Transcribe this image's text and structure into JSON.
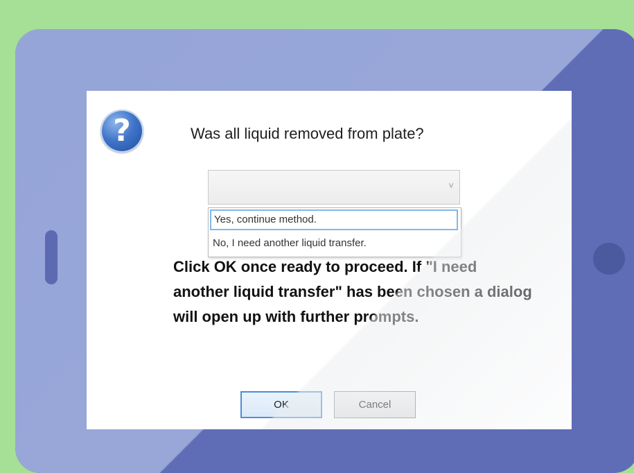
{
  "dialog": {
    "icon": "question-icon",
    "icon_glyph": "?",
    "prompt": "Was all liquid removed from plate?",
    "dropdown": {
      "selected_value": "",
      "arrow_glyph": "˅",
      "options": [
        "Yes, continue method.",
        "No, I need another liquid transfer."
      ]
    },
    "instructions": "Click OK once ready to proceed. If \"I need another liquid transfer\" has been chosen a dialog will open up with further prompts.",
    "buttons": {
      "ok_label": "OK",
      "cancel_label": "Cancel"
    }
  },
  "colors": {
    "background": "#a6df96",
    "tablet_body": "#5e6db6",
    "tablet_highlight": "#96a5d8",
    "focus_blue": "#7fb8ea"
  }
}
